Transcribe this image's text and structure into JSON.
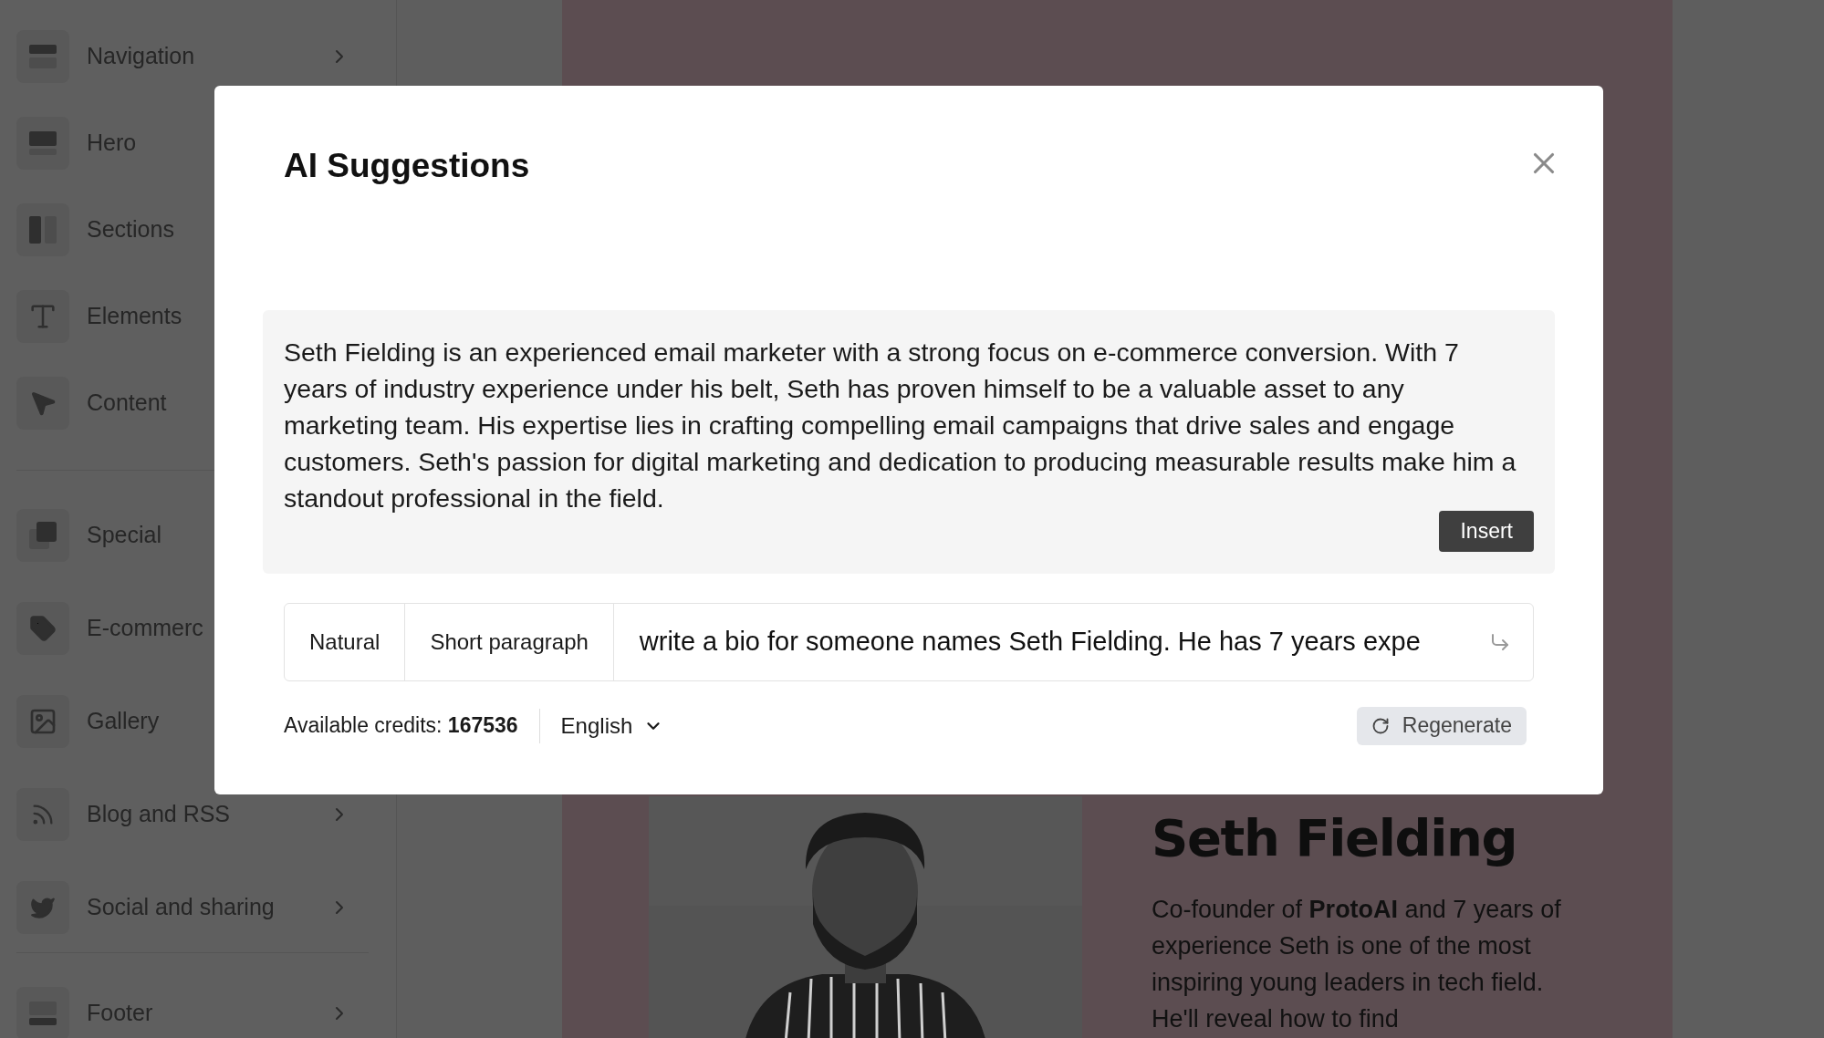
{
  "sidebar": {
    "groups": [
      {
        "items": [
          {
            "label": "Navigation",
            "kind": "navigation",
            "chevron": true
          },
          {
            "label": "Hero",
            "kind": "hero",
            "chevron": false
          },
          {
            "label": "Sections",
            "kind": "sections",
            "chevron": false
          },
          {
            "label": "Elements",
            "kind": "elements",
            "chevron": false
          },
          {
            "label": "Content",
            "kind": "content",
            "chevron": false
          }
        ]
      },
      {
        "items": [
          {
            "label": "Special",
            "kind": "special",
            "chevron": false
          },
          {
            "label": "E-commerc",
            "kind": "tag",
            "chevron": false
          },
          {
            "label": "Gallery",
            "kind": "gallery",
            "chevron": false
          },
          {
            "label": "Blog and RSS",
            "kind": "rss",
            "chevron": true
          },
          {
            "label": "Social and sharing",
            "kind": "bird",
            "chevron": true
          }
        ]
      },
      {
        "items": [
          {
            "label": "Footer",
            "kind": "footer",
            "chevron": true
          }
        ]
      }
    ]
  },
  "canvas": {
    "heading": "Seth Fielding",
    "bio": "Co-founder of **ProtoAI** and 7 years of experience Seth is one of the most inspiring young leaders in tech field. He'll reveal how to find"
  },
  "dialog": {
    "title": "AI Suggestions",
    "suggestion": "Seth Fielding is an experienced email marketer with a strong focus on e-commerce conversion. With 7 years of industry experience under his belt, Seth has proven himself to be a valuable asset to any marketing team. His expertise lies in crafting compelling email campaigns that drive sales and engage customers. Seth's passion for digital marketing and dedication to producing measurable results make him a standout professional in the field.",
    "insert_button": "Insert",
    "tone": "Natural",
    "length": "Short paragraph",
    "prompt": "write a bio for someone names Seth Fielding. He has 7 years expe",
    "credits_label": "Available credits: ",
    "credits": "167536",
    "language": "English",
    "regenerate_button": "Regenerate"
  }
}
